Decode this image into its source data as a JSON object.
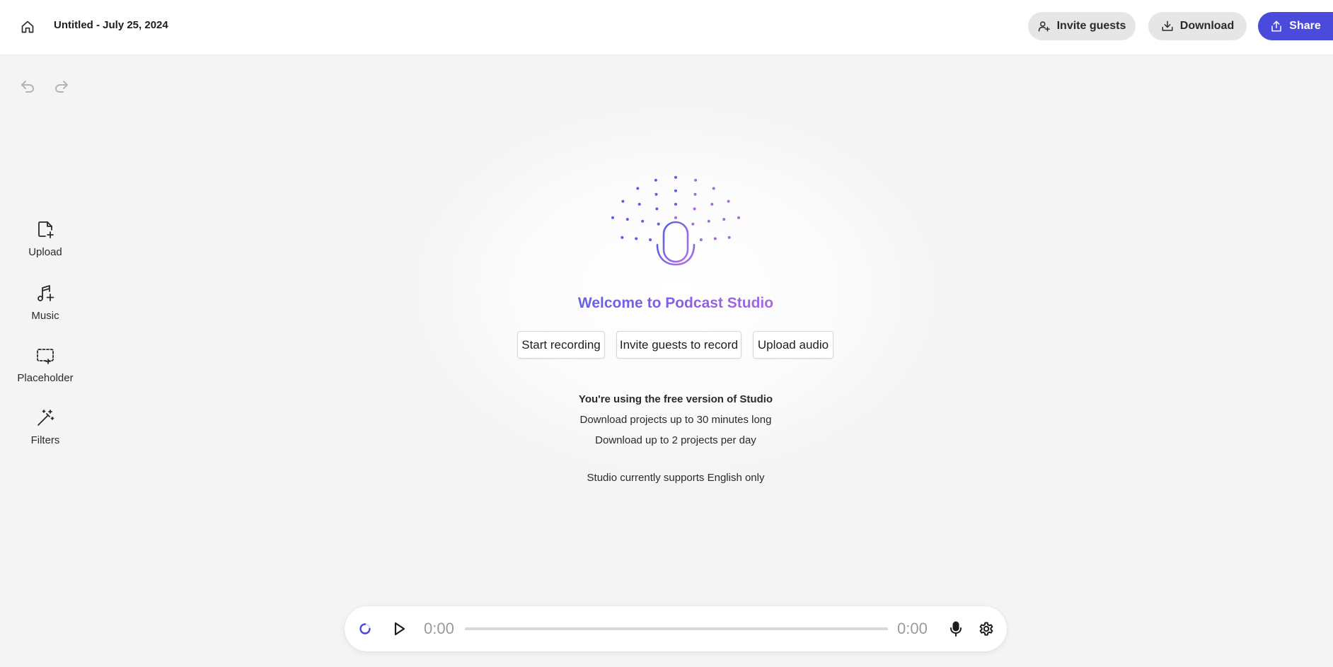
{
  "header": {
    "title": "Untitled - July 25, 2024",
    "invite_label": "Invite guests",
    "download_label": "Download",
    "share_label": "Share"
  },
  "tools": [
    {
      "label": "Upload",
      "icon": "file-plus-icon"
    },
    {
      "label": "Music",
      "icon": "music-plus-icon"
    },
    {
      "label": "Placeholder",
      "icon": "dashed-box-plus-icon"
    },
    {
      "label": "Filters",
      "icon": "magic-wand-icon"
    }
  ],
  "main": {
    "welcome": "Welcome to Podcast Studio",
    "actions": [
      "Start recording",
      "Invite guests to record",
      "Upload audio"
    ],
    "info_heading": "You're using the free version of Studio",
    "info_lines": [
      "Download projects up to 30 minutes long",
      "Download up to 2 projects per day"
    ],
    "language_note": "Studio currently supports English only"
  },
  "player": {
    "current_time": "0:00",
    "total_time": "0:00",
    "progress": 0
  },
  "colors": {
    "accent": "#4b4bdb",
    "gradient_start": "#5560e6",
    "gradient_end": "#b66fe0"
  }
}
